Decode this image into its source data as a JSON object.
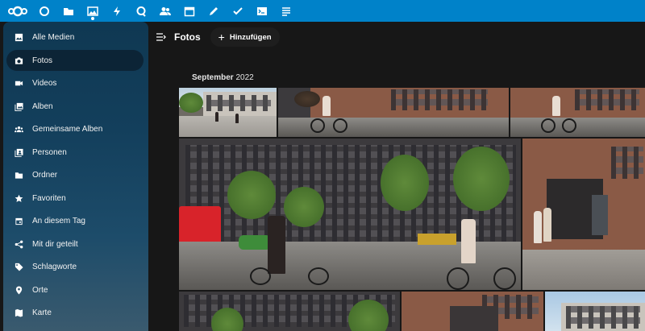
{
  "colors": {
    "accent": "#0082c9",
    "background": "#171717",
    "sidebar": "#133f5c"
  },
  "topbar": {
    "apps": [
      {
        "icon": "dashboard-icon"
      },
      {
        "icon": "files-icon"
      },
      {
        "icon": "photos-icon",
        "active": true
      },
      {
        "icon": "activity-icon"
      },
      {
        "icon": "talk-icon"
      },
      {
        "icon": "contacts-icon"
      },
      {
        "icon": "calendar-icon"
      },
      {
        "icon": "notes-icon"
      },
      {
        "icon": "tasks-icon"
      },
      {
        "icon": "terminal-icon"
      },
      {
        "icon": "text-icon"
      }
    ]
  },
  "sidebar": {
    "items": [
      {
        "label": "Alle Medien",
        "icon": "image-icon"
      },
      {
        "label": "Fotos",
        "icon": "camera-icon",
        "active": true
      },
      {
        "label": "Videos",
        "icon": "video-icon"
      },
      {
        "label": "Alben",
        "icon": "album-icon"
      },
      {
        "label": "Gemeinsame Alben",
        "icon": "shared-album-icon"
      },
      {
        "label": "Personen",
        "icon": "people-icon"
      },
      {
        "label": "Ordner",
        "icon": "folder-icon"
      },
      {
        "label": "Favoriten",
        "icon": "star-icon"
      },
      {
        "label": "An diesem Tag",
        "icon": "calendar-day-icon"
      },
      {
        "label": "Mit dir geteilt",
        "icon": "share-icon"
      },
      {
        "label": "Schlagworte",
        "icon": "tag-icon"
      },
      {
        "label": "Orte",
        "icon": "location-icon"
      },
      {
        "label": "Karte",
        "icon": "map-icon"
      }
    ]
  },
  "header": {
    "title": "Fotos",
    "add_label": "Hinzufügen"
  },
  "timeline": {
    "month": "September",
    "year": "2022"
  }
}
